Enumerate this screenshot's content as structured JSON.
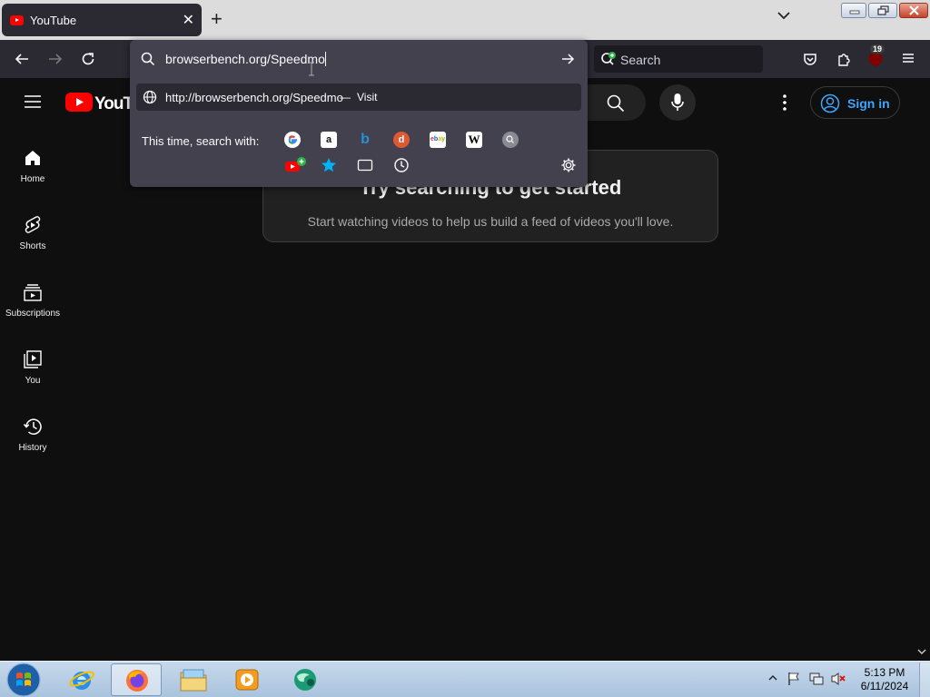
{
  "browser": {
    "tab": {
      "title": "YouTube"
    },
    "toolbar": {
      "search_placeholder": "Search",
      "notification_count": "19"
    },
    "urlbar": {
      "value": "browserbench.org/Speedmo",
      "suggestion_url": "http://browserbench.org/Speedmo",
      "suggestion_sep": "—",
      "suggestion_action": "Visit",
      "oneoff_label": "This time, search with:",
      "engines": [
        "google-icon",
        "amazon-icon",
        "bing-icon",
        "duckduckgo-icon",
        "ebay-icon",
        "wikipedia-icon",
        "generic-search-icon"
      ],
      "modes": [
        "youtube-add-icon",
        "bookmarks-icon",
        "tabs-icon",
        "history-icon"
      ]
    }
  },
  "youtube": {
    "logo_text": "YouTube",
    "sign_in": "Sign in",
    "guide": [
      {
        "label": "Home"
      },
      {
        "label": "Shorts"
      },
      {
        "label": "Subscriptions"
      },
      {
        "label": "You"
      },
      {
        "label": "History"
      }
    ],
    "empty_title": "Try searching to get started",
    "empty_sub": "Start watching videos to help us build a feed of videos you'll love."
  },
  "taskbar": {
    "time": "5:13 PM",
    "date": "6/11/2024"
  },
  "colors": {
    "yt_red": "#ff0000",
    "link_blue": "#3ea6ff",
    "panel": "#42414d",
    "toolbar": "#2b2a33"
  }
}
